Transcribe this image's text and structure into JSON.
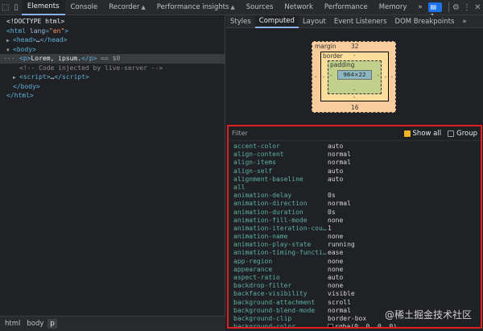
{
  "toolbar": {
    "tabs": [
      {
        "label": "Elements",
        "active": true
      },
      {
        "label": "Console"
      },
      {
        "label": "Recorder",
        "warn": "▲"
      },
      {
        "label": "Performance insights",
        "warn": "▲"
      },
      {
        "label": "Sources"
      },
      {
        "label": "Network"
      },
      {
        "label": "Performance"
      },
      {
        "label": "Memory"
      }
    ],
    "more": "»",
    "message_count": "1"
  },
  "dom": {
    "doctype": "<!DOCTYPE html>",
    "html_tag": "html",
    "html_attr": "lang",
    "html_lang": "\"en\"",
    "head_tag": "head",
    "body_tag": "body",
    "p_text": "Lorem, ipsum.",
    "p_suffix": "== $0",
    "comment": "<!-- Code injected by live-server -->",
    "script_tag": "script",
    "ellipsis": "…",
    "body_close": "</body>",
    "html_close": "</html>"
  },
  "breadcrumb": [
    "html",
    "body",
    "p"
  ],
  "sub_tabs": [
    "Styles",
    "Computed",
    "Layout",
    "Event Listeners",
    "DOM Breakpoints"
  ],
  "sub_more": "»",
  "box_model": {
    "margin_label": "margin",
    "margin_top": "32",
    "margin_bottom": "16",
    "border_label": "border",
    "padding_label": "padding",
    "content": "964×22",
    "dash": "-"
  },
  "computed": {
    "filter_placeholder": "Filter",
    "show_all": "Show all",
    "group": "Group",
    "properties": [
      {
        "name": "accent-color",
        "value": "auto"
      },
      {
        "name": "align-content",
        "value": "normal"
      },
      {
        "name": "align-items",
        "value": "normal"
      },
      {
        "name": "align-self",
        "value": "auto"
      },
      {
        "name": "alignment-baseline",
        "value": "auto"
      },
      {
        "name": "all",
        "value": ""
      },
      {
        "name": "animation-delay",
        "value": "0s"
      },
      {
        "name": "animation-direction",
        "value": "normal"
      },
      {
        "name": "animation-duration",
        "value": "0s"
      },
      {
        "name": "animation-fill-mode",
        "value": "none"
      },
      {
        "name": "animation-iteration-cou…",
        "value": "1"
      },
      {
        "name": "animation-name",
        "value": "none"
      },
      {
        "name": "animation-play-state",
        "value": "running"
      },
      {
        "name": "animation-timing-functi…",
        "value": "ease"
      },
      {
        "name": "app-region",
        "value": "none"
      },
      {
        "name": "appearance",
        "value": "none"
      },
      {
        "name": "aspect-ratio",
        "value": "auto"
      },
      {
        "name": "backdrop-filter",
        "value": "none"
      },
      {
        "name": "backface-visibility",
        "value": "visible"
      },
      {
        "name": "background-attachment",
        "value": "scroll"
      },
      {
        "name": "background-blend-mode",
        "value": "normal"
      },
      {
        "name": "background-clip",
        "value": "border-box"
      },
      {
        "name": "background-color",
        "value": "rgba(0, 0, 0, 0)",
        "swatch": true
      }
    ]
  },
  "watermark": "@稀土掘金技术社区",
  "colors": {
    "accent": "#8ab4f8",
    "highlight_border": "#e02020",
    "checkbox": "#f0b429"
  }
}
